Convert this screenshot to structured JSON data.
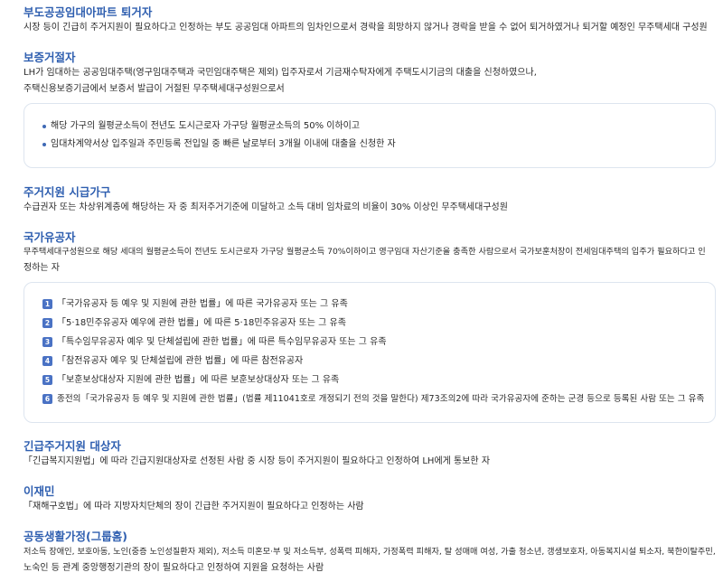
{
  "sections": {
    "s1": {
      "title": "부도공공임대아파트 퇴거자",
      "desc": "시장 등이 긴급히 주거지원이 필요하다고 인정하는 부도 공공임대 아파트의 임차인으로서 경락을 희망하지 않거나 경락을 받을 수 없어 퇴거하였거나 퇴거할 예정인 무주택세대 구성원"
    },
    "s2": {
      "title": "보증거절자",
      "desc_line1": "LH가 임대하는 공공임대주택(영구임대주택과 국민임대주택은 제외) 입주자로서 기금재수탁자에게 주택도시기금의 대출을 신청하였으나,",
      "desc_line2": "주택신용보증기금에서 보증서 발급이 거절된 무주택세대구성원으로서",
      "bullets": [
        "해당 가구의 월평균소득이 전년도 도시근로자 가구당 월평균소득의 50% 이하이고",
        "임대차계약서상 입주일과 주민등록 전입일 중 빠른 날로부터 3개월 이내에 대출을 신청한 자"
      ]
    },
    "s3": {
      "title": "주거지원 시급가구",
      "desc": "수급권자 또는 차상위계층에 해당하는 자 중 최저주거기준에 미달하고 소득 대비 임차료의 비율이 30% 이상인 무주택세대구성원"
    },
    "s4": {
      "title": "국가유공자",
      "desc_line1": "무주택세대구성원으로 해당 세대의 월평균소득이 전년도 도시근로자 가구당 월평균소득 70%이하이고 영구임대 자산기준을 충족한 사람으로서 국가보훈처장이 전세임대주택의 입주가 필요하다고 인",
      "desc_line2": "정하는 자",
      "items": [
        {
          "num": "1",
          "text": "「국가유공자 등 예우 및 지원에 관한 법률」에 따른 국가유공자 또는 그 유족"
        },
        {
          "num": "2",
          "text": "「5·18민주유공자 예우에 관한 법률」에 따른 5·18민주유공자 또는 그 유족"
        },
        {
          "num": "3",
          "text": "「특수임무유공자 예우 및 단체설립에 관한 법률」에 따른 특수임무유공자 또는 그 유족"
        },
        {
          "num": "4",
          "text": "「참전유공자 예우 및 단체설립에 관한 법률」에 따른 참전유공자"
        },
        {
          "num": "5",
          "text": "「보훈보상대상자 지원에 관한 법률」에 따른 보훈보상대상자 또는 그 유족"
        },
        {
          "num": "6",
          "text": "종전의「국가유공자 등 예우 및 지원에 관한 법률」(법률 제11041호로 개정되기 전의 것을 말한다) 제73조의2에 따라 국가유공자에 준하는 군경 등으로 등록된 사람 또는 그 유족"
        }
      ]
    },
    "s5": {
      "title": "긴급주거지원 대상자",
      "desc": "「긴급복지지원법」에 따라 긴급지원대상자로 선정된 사람 중 시장 등이 주거지원이 필요하다고 인정하여 LH에게 통보한 자"
    },
    "s6": {
      "title": "이재민",
      "desc": "「재해구호법」에 따라 지방자치단체의 장이 긴급한 주거지원이 필요하다고 인정하는 사람"
    },
    "s7": {
      "title": "공동생활가정(그룹홈)",
      "desc_line1": "저소득 장애인, 보호아동, 노인(중증 노인성질환자 제외), 저소득 미혼모·부 및 저소득부, 성폭력 피해자, 가정폭력 피해자, 탈 성매매 여성, 가출 청소년, 갱생보호자, 아동복지시설 퇴소자, 북한이탈주민,",
      "desc_line2": "노숙인 등 관계 중앙행정기관의 장이 필요하다고 인정하여 지원을 요청하는 사람"
    }
  },
  "colors": {
    "heading": "#2f5fb0",
    "badge": "#4a72c4",
    "box_border": "#dde5ef"
  },
  "icons": {
    "bullet": "bullet-dot-icon",
    "number": "number-badge-icon"
  }
}
